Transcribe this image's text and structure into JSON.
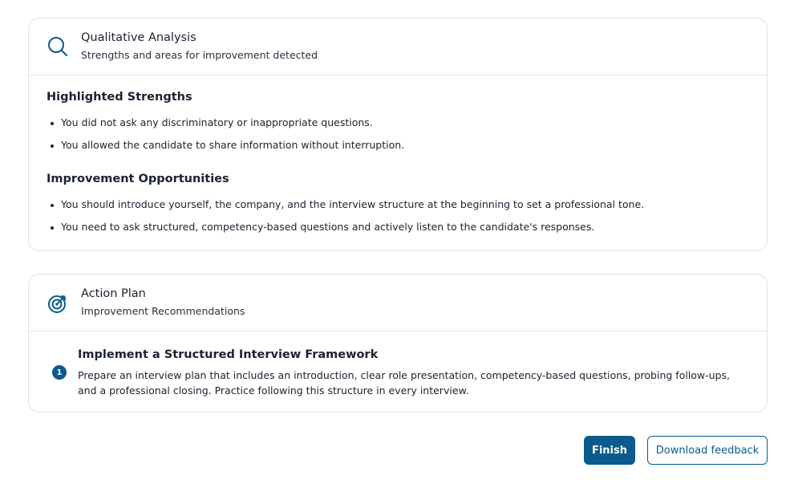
{
  "analysis": {
    "title": "Qualitative Analysis",
    "subtitle": "Strengths and areas for improvement detected",
    "icon": "search-icon",
    "strengths": {
      "heading": "Highlighted Strengths",
      "items": [
        "You did not ask any discriminatory or inappropriate questions.",
        "You allowed the candidate to share information without interruption."
      ]
    },
    "opportunities": {
      "heading": "Improvement Opportunities",
      "items": [
        "You should introduce yourself, the company, and the interview structure at the beginning to set a professional tone.",
        "You need to ask structured, competency-based questions and actively listen to the candidate's responses."
      ]
    }
  },
  "plan": {
    "title": "Action Plan",
    "subtitle": "Improvement Recommendations",
    "icon": "target-icon",
    "steps": [
      {
        "number": "1",
        "title": "Implement a Structured Interview Framework",
        "description": "Prepare an interview plan that includes an introduction, clear role presentation, competency-based questions, probing follow-ups, and a professional closing. Practice following this structure in every interview."
      }
    ]
  },
  "actions": {
    "finish_label": "Finish",
    "download_label": "Download feedback"
  },
  "colors": {
    "accent": "#0b5b8c",
    "border": "#dfe3e8",
    "text": "#1b2230"
  }
}
